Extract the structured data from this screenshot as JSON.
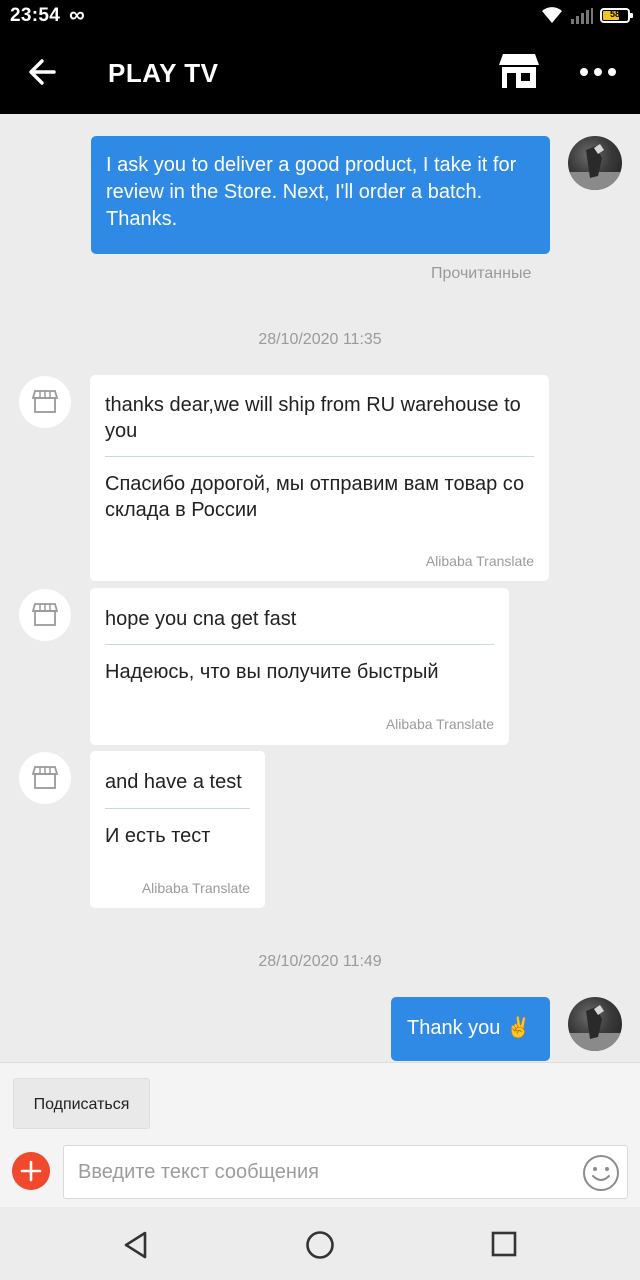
{
  "status_bar": {
    "time": "23:54",
    "loop_glyph": "∞",
    "battery_level": "58",
    "icons": [
      "infinity-icon",
      "wifi-icon",
      "signal-icon",
      "battery-icon"
    ]
  },
  "app_bar": {
    "title": "PLAY TV",
    "icons": [
      "back-arrow-icon",
      "store-icon",
      "more-icon"
    ]
  },
  "messages": [
    {
      "direction": "outgoing",
      "text": "I ask you to deliver a good product, I take it for review in the Store. Next, I'll order a batch. Thanks.",
      "status": "Прочитанные"
    },
    {
      "type": "timestamp",
      "text": "28/10/2020 11:35"
    },
    {
      "direction": "incoming",
      "original": "thanks dear,we will ship from RU warehouse to you",
      "translation": "Спасибо дорогой, мы отправим вам товар со склада в России",
      "provider": "Alibaba Translate"
    },
    {
      "direction": "incoming",
      "original": "hope you cna get fast",
      "translation": "Надеюсь, что вы получите быстрый",
      "provider": "Alibaba Translate"
    },
    {
      "direction": "incoming",
      "original": "and have a test",
      "translation": "И есть тест",
      "provider": "Alibaba Translate"
    },
    {
      "type": "timestamp",
      "text": "28/10/2020 11:49"
    },
    {
      "direction": "outgoing",
      "text": "Thank you ✌️"
    }
  ],
  "composer": {
    "subscribe_label": "Подписаться",
    "input_placeholder": "Введите текст сообщения",
    "input_value": "",
    "icons": [
      "plus-icon",
      "emoji-icon"
    ]
  },
  "colors": {
    "outgoing_bubble": "#2f8ae5",
    "incoming_bubble": "#ffffff",
    "header": "#000000",
    "chat_bg": "#ececec",
    "plus_button": "#f0492e"
  },
  "nav_bar": {
    "icons": [
      "nav-back-icon",
      "nav-home-icon",
      "nav-recents-icon"
    ]
  }
}
